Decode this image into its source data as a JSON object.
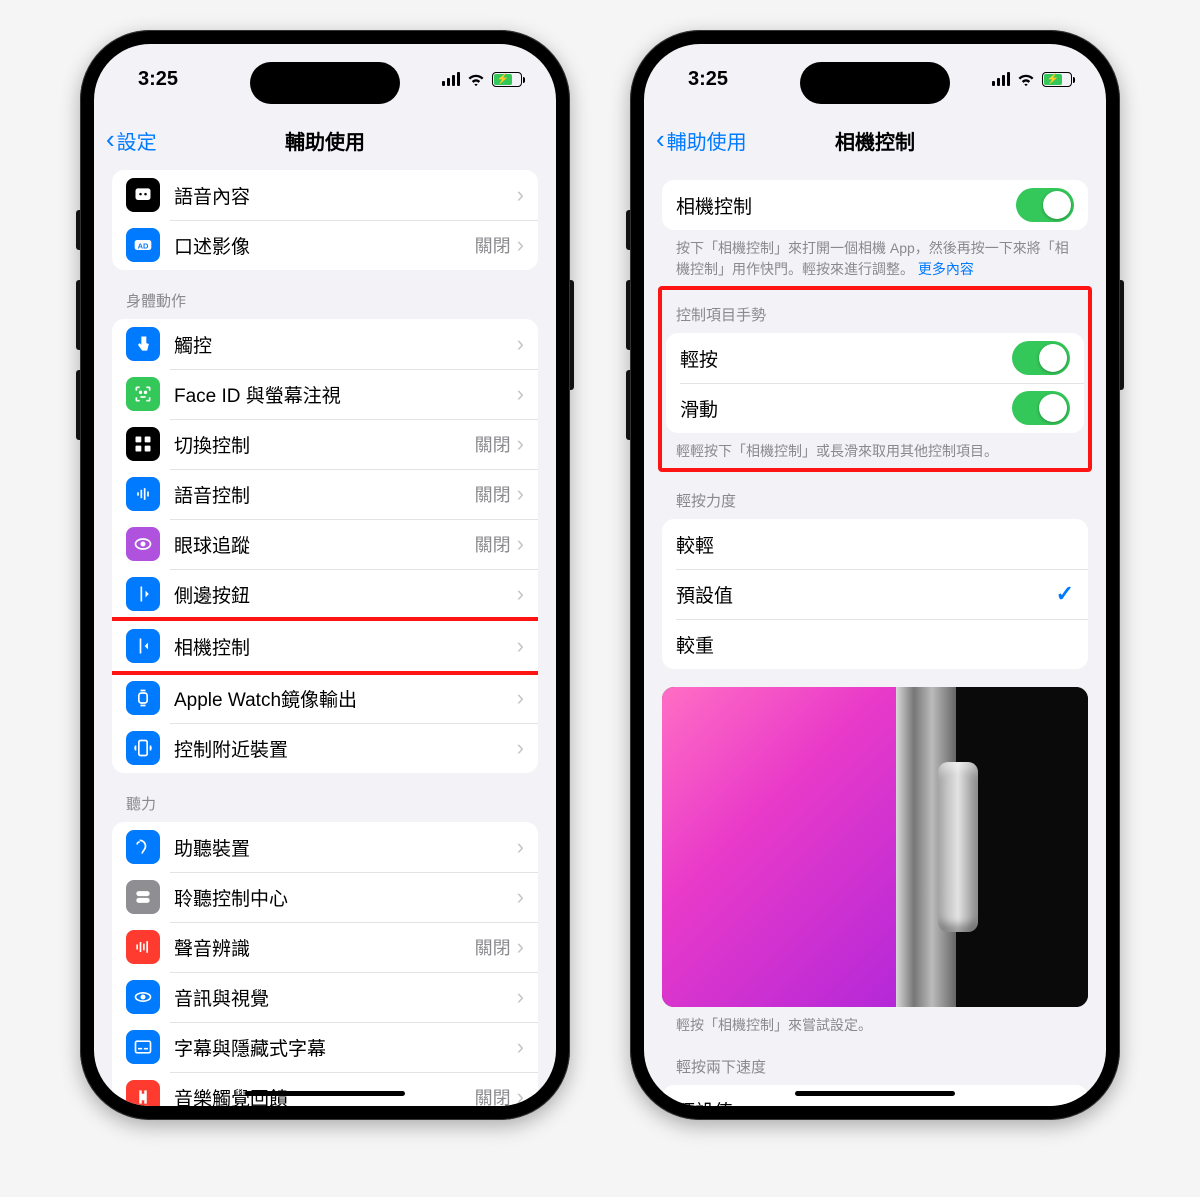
{
  "status": {
    "time": "3:25"
  },
  "left": {
    "back": "設定",
    "title": "輔助使用",
    "top_group": [
      {
        "icon": "speech-icon",
        "bg": "#000",
        "label": "語音內容"
      },
      {
        "icon": "audio-desc-icon",
        "bg": "#007aff",
        "label": "口述影像",
        "value": "關閉"
      }
    ],
    "body_header": "身體動作",
    "body_group": [
      {
        "icon": "touch-icon",
        "bg": "#007aff",
        "label": "觸控"
      },
      {
        "icon": "faceid-icon",
        "bg": "#34c759",
        "label": "Face ID 與螢幕注視"
      },
      {
        "icon": "switch-icon",
        "bg": "#000",
        "label": "切換控制",
        "value": "關閉"
      },
      {
        "icon": "voice-icon",
        "bg": "#007aff",
        "label": "語音控制",
        "value": "關閉"
      },
      {
        "icon": "eye-icon",
        "bg": "#af52de",
        "label": "眼球追蹤",
        "value": "關閉"
      },
      {
        "icon": "side-icon",
        "bg": "#007aff",
        "label": "側邊按鈕"
      },
      {
        "icon": "camera-ctrl-icon",
        "bg": "#007aff",
        "label": "相機控制",
        "highlight": true
      },
      {
        "icon": "watch-icon",
        "bg": "#007aff",
        "label": "Apple Watch鏡像輸出"
      },
      {
        "icon": "nearby-icon",
        "bg": "#007aff",
        "label": "控制附近裝置"
      }
    ],
    "hearing_header": "聽力",
    "hearing_group": [
      {
        "icon": "hearing-icon",
        "bg": "#007aff",
        "label": "助聽裝置"
      },
      {
        "icon": "cc-center-icon",
        "bg": "#8e8e93",
        "label": "聆聽控制中心"
      },
      {
        "icon": "sound-rec-icon",
        "bg": "#ff3b30",
        "label": "聲音辨識",
        "value": "關閉"
      },
      {
        "icon": "audio-vis-icon",
        "bg": "#007aff",
        "label": "音訊與視覺"
      },
      {
        "icon": "subtitle-icon",
        "bg": "#007aff",
        "label": "字幕與隱藏式字幕"
      },
      {
        "icon": "haptic-icon",
        "bg": "#ff3b30",
        "label": "音樂觸覺回饋",
        "value": "關閉"
      }
    ]
  },
  "right": {
    "back": "輔助使用",
    "title": "相機控制",
    "main_toggle_label": "相機控制",
    "main_footer": "按下「相機控制」來打開一個相機 App，然後再按一下來將「相機控制」用作快門。輕按來進行調整。",
    "main_footer_link": "更多內容",
    "gesture_header": "控制項目手勢",
    "gesture_group": [
      {
        "label": "輕按"
      },
      {
        "label": "滑動"
      }
    ],
    "gesture_footer": "輕輕按下「相機控制」或長滑來取用其他控制項目。",
    "force_header": "輕按力度",
    "force_group": [
      {
        "label": "較輕"
      },
      {
        "label": "預設值",
        "checked": true
      },
      {
        "label": "較重"
      }
    ],
    "illust_footer": "輕按「相機控制」來嘗試設定。",
    "speed_header": "輕按兩下速度",
    "speed_first": "預設值"
  }
}
